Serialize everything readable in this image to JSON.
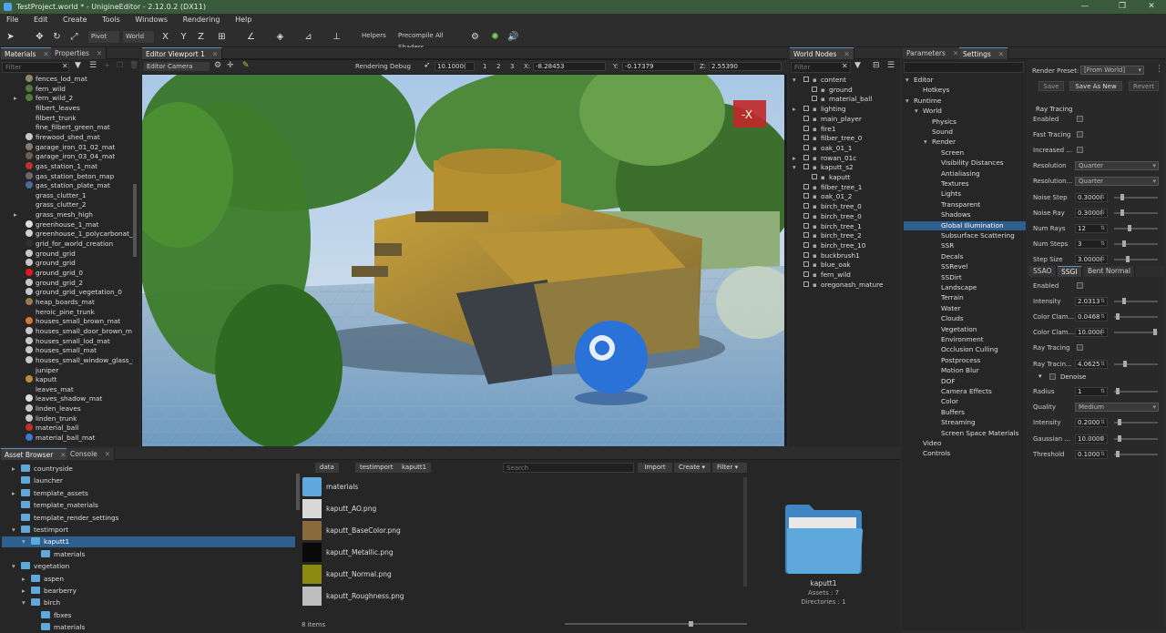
{
  "window": {
    "title": "TestProject.world * - UnigineEditor - 2.12.0.2 (DX11)"
  },
  "menu": [
    "File",
    "Edit",
    "Create",
    "Tools",
    "Windows",
    "Rendering",
    "Help"
  ],
  "toolbar": {
    "pivot": "Pivot",
    "world": "World",
    "x": "X",
    "y": "Y",
    "z": "Z",
    "helpers": "Helpers",
    "precompile": "Precompile All Shaders"
  },
  "materials_panel": {
    "tabs": [
      "Materials",
      "Properties"
    ],
    "search_placeholder": "Filter",
    "items": [
      {
        "label": "fences_lod_mat",
        "color": "#8a8a6a"
      },
      {
        "label": "fern_wild",
        "color": "#4f7a3a"
      },
      {
        "label": "fern_wild_2",
        "color": "#4f7a3a"
      },
      {
        "label": "filbert_leaves",
        "color": ""
      },
      {
        "label": "filbert_trunk",
        "color": ""
      },
      {
        "label": "fine_filbert_green_mat",
        "color": ""
      },
      {
        "label": "firewood_shed_mat",
        "color": "#c8c8c8"
      },
      {
        "label": "garage_iron_01_02_mat",
        "color": "#8a7a6a"
      },
      {
        "label": "garage_iron_03_04_mat",
        "color": "#6a6058"
      },
      {
        "label": "gas_station_1_mat",
        "color": "#c03030"
      },
      {
        "label": "gas_station_beton_map",
        "color": "#6a6a6a"
      },
      {
        "label": "gas_station_plate_mat",
        "color": "#4a6a9a"
      },
      {
        "label": "grass_clutter_1",
        "color": ""
      },
      {
        "label": "grass_clutter_2",
        "color": ""
      },
      {
        "label": "grass_mesh_high",
        "color": ""
      },
      {
        "label": "greenhouse_1_mat",
        "color": "#dddddd"
      },
      {
        "label": "greenhouse_1_polycarbonat_m",
        "color": "#d0d0d0"
      },
      {
        "label": "grid_for_world_creation",
        "color": "#303030"
      },
      {
        "label": "ground_grid",
        "color": "#c8c8c8"
      },
      {
        "label": "ground_grid",
        "color": "#c8c8c8"
      },
      {
        "label": "ground_grid_0",
        "color": "#dd1a1a"
      },
      {
        "label": "ground_grid_2",
        "color": "#c8c8c8"
      },
      {
        "label": "ground_grid_vegetation_0",
        "color": "#c8c8c8"
      },
      {
        "label": "heap_boards_mat",
        "color": "#9a7a50"
      },
      {
        "label": "heroic_pine_trunk",
        "color": ""
      },
      {
        "label": "houses_small_brown_mat",
        "color": "#d07a2a"
      },
      {
        "label": "houses_small_door_brown_m",
        "color": "#c8c8c8"
      },
      {
        "label": "houses_small_lod_mat",
        "color": "#c8c8c8"
      },
      {
        "label": "houses_small_mat",
        "color": "#c8c8c8"
      },
      {
        "label": "houses_small_window_glass_n",
        "color": "#c8c8c8"
      },
      {
        "label": "juniper",
        "color": ""
      },
      {
        "label": "kaputt",
        "color": "#b09040"
      },
      {
        "label": "leaves_mat",
        "color": ""
      },
      {
        "label": "leaves_shadow_mat",
        "color": "#dddddd"
      },
      {
        "label": "linden_leaves",
        "color": "#c8c8c8"
      },
      {
        "label": "linden_trunk",
        "color": "#c8c8c8"
      },
      {
        "label": "material_ball",
        "color": "#c03030"
      },
      {
        "label": "material_ball_mat",
        "color": "#3a7ad0"
      }
    ]
  },
  "viewport": {
    "tab": "Editor Viewport 1",
    "camera": "Editor Camera",
    "rendering_debug": "Rendering Debug",
    "speed": "10.1000(",
    "speeds": [
      "1",
      "2",
      "3"
    ],
    "x_label": "X:",
    "x": "-8.28453",
    "y_label": "Y:",
    "y": "-0.17379",
    "z_label": "Z:",
    "z": "2.55390",
    "axis_gizmo": "-X"
  },
  "world_nodes": {
    "tab": "World Nodes",
    "search_placeholder": "Filter",
    "items": [
      {
        "label": "content",
        "indent": 0,
        "expand": "▾"
      },
      {
        "label": "ground",
        "indent": 1,
        "expand": ""
      },
      {
        "label": "material_ball",
        "indent": 1,
        "expand": ""
      },
      {
        "label": "lighting",
        "indent": 0,
        "expand": "▸"
      },
      {
        "label": "main_player",
        "indent": 0,
        "expand": ""
      },
      {
        "label": "fire1",
        "indent": 0,
        "expand": ""
      },
      {
        "label": "filber_tree_0",
        "indent": 0,
        "expand": ""
      },
      {
        "label": "oak_01_1",
        "indent": 0,
        "expand": ""
      },
      {
        "label": "rowan_01c",
        "indent": 0,
        "expand": "▸"
      },
      {
        "label": "kaputt_s2",
        "indent": 0,
        "expand": "▾"
      },
      {
        "label": "kaputt",
        "indent": 1,
        "expand": ""
      },
      {
        "label": "filber_tree_1",
        "indent": 0,
        "expand": ""
      },
      {
        "label": "oak_01_2",
        "indent": 0,
        "expand": ""
      },
      {
        "label": "birch_tree_0",
        "indent": 0,
        "expand": ""
      },
      {
        "label": "birch_tree_0",
        "indent": 0,
        "expand": ""
      },
      {
        "label": "birch_tree_1",
        "indent": 0,
        "expand": ""
      },
      {
        "label": "birch_tree_2",
        "indent": 0,
        "expand": ""
      },
      {
        "label": "birch_tree_10",
        "indent": 0,
        "expand": ""
      },
      {
        "label": "buckbrush1",
        "indent": 0,
        "expand": ""
      },
      {
        "label": "blue_oak",
        "indent": 0,
        "expand": ""
      },
      {
        "label": "fern_wild",
        "indent": 0,
        "expand": ""
      },
      {
        "label": "oregonash_mature",
        "indent": 0,
        "expand": ""
      }
    ]
  },
  "settings_panel": {
    "tabs": [
      "Parameters",
      "Settings"
    ],
    "tree": [
      {
        "label": "Editor",
        "indent": 0,
        "expand": "▾"
      },
      {
        "label": "Hotkeys",
        "indent": 1,
        "expand": ""
      },
      {
        "label": "Runtime",
        "indent": 0,
        "expand": "▾"
      },
      {
        "label": "World",
        "indent": 1,
        "expand": "▾"
      },
      {
        "label": "Physics",
        "indent": 2,
        "expand": ""
      },
      {
        "label": "Sound",
        "indent": 2,
        "expand": ""
      },
      {
        "label": "Render",
        "indent": 2,
        "expand": "▾"
      },
      {
        "label": "Screen",
        "indent": 3,
        "expand": ""
      },
      {
        "label": "Visibility Distances",
        "indent": 3,
        "expand": ""
      },
      {
        "label": "Antialiasing",
        "indent": 3,
        "expand": ""
      },
      {
        "label": "Textures",
        "indent": 3,
        "expand": ""
      },
      {
        "label": "Lights",
        "indent": 3,
        "expand": ""
      },
      {
        "label": "Transparent",
        "indent": 3,
        "expand": ""
      },
      {
        "label": "Shadows",
        "indent": 3,
        "expand": ""
      },
      {
        "label": "Global Illumination",
        "indent": 3,
        "expand": ""
      },
      {
        "label": "Subsurface Scattering",
        "indent": 3,
        "expand": ""
      },
      {
        "label": "SSR",
        "indent": 3,
        "expand": ""
      },
      {
        "label": "Decals",
        "indent": 3,
        "expand": ""
      },
      {
        "label": "SSRevel",
        "indent": 3,
        "expand": ""
      },
      {
        "label": "SSDirt",
        "indent": 3,
        "expand": ""
      },
      {
        "label": "Landscape",
        "indent": 3,
        "expand": ""
      },
      {
        "label": "Terrain",
        "indent": 3,
        "expand": ""
      },
      {
        "label": "Water",
        "indent": 3,
        "expand": ""
      },
      {
        "label": "Clouds",
        "indent": 3,
        "expand": ""
      },
      {
        "label": "Vegetation",
        "indent": 3,
        "expand": ""
      },
      {
        "label": "Environment",
        "indent": 3,
        "expand": ""
      },
      {
        "label": "Occlusion Culling",
        "indent": 3,
        "expand": ""
      },
      {
        "label": "Postprocess",
        "indent": 3,
        "expand": ""
      },
      {
        "label": "Motion Blur",
        "indent": 3,
        "expand": ""
      },
      {
        "label": "DOF",
        "indent": 3,
        "expand": ""
      },
      {
        "label": "Camera Effects",
        "indent": 3,
        "expand": ""
      },
      {
        "label": "Color",
        "indent": 3,
        "expand": ""
      },
      {
        "label": "Buffers",
        "indent": 3,
        "expand": ""
      },
      {
        "label": "Streaming",
        "indent": 3,
        "expand": ""
      },
      {
        "label": "Screen Space Materials",
        "indent": 3,
        "expand": ""
      },
      {
        "label": "Video",
        "indent": 1,
        "expand": ""
      },
      {
        "label": "Controls",
        "indent": 1,
        "expand": ""
      }
    ],
    "selected": "Global Illumination"
  },
  "render_props": {
    "preset_label": "Render Preset:",
    "preset_value": "[From World]",
    "buttons": [
      "Save",
      "Save As New",
      "Revert"
    ],
    "ray_tracing_title": "Ray Tracing",
    "ray_tracing": [
      {
        "label": "Enabled",
        "type": "check"
      },
      {
        "label": "Fast Tracing",
        "type": "check"
      },
      {
        "label": "Increased ...",
        "type": "check"
      },
      {
        "label": "Resolution",
        "type": "dd",
        "value": "Quarter"
      },
      {
        "label": "Resolution...",
        "type": "dd",
        "value": "Quarter"
      },
      {
        "label": "Noise Step",
        "type": "num",
        "value": "0.3000(",
        "level": 0.15
      },
      {
        "label": "Noise Ray",
        "type": "num",
        "value": "0.3000(",
        "level": 0.15
      },
      {
        "label": "Num Rays",
        "type": "num",
        "value": "12",
        "level": 0.35
      },
      {
        "label": "Num Steps",
        "type": "num",
        "value": "3",
        "level": 0.2
      },
      {
        "label": "Step Size",
        "type": "num",
        "value": "3.0000(",
        "level": 0.3
      }
    ],
    "sub_tabs": [
      "SSAO",
      "SSGI",
      "Bent Normal"
    ],
    "ssgi": [
      {
        "label": "Enabled",
        "type": "check"
      },
      {
        "label": "Intensity",
        "type": "num",
        "value": "2.0313",
        "level": 0.2
      },
      {
        "label": "Color Clam...",
        "type": "num",
        "value": "0.0468",
        "level": 0.05
      },
      {
        "label": "Color Clam...",
        "type": "num",
        "value": "10.000(",
        "level": 0.98
      },
      {
        "label": "Ray Tracing",
        "type": "check"
      },
      {
        "label": "Ray Tracin...",
        "type": "num",
        "value": "4.0625",
        "level": 0.22
      }
    ],
    "denoise_title": "Denoise",
    "denoise": [
      {
        "label": "Radius",
        "type": "num",
        "value": "1",
        "level": 0.04
      },
      {
        "label": "Quality",
        "type": "dd",
        "value": "Medium"
      },
      {
        "label": "Intensity",
        "type": "num",
        "value": "0.2000",
        "level": 0.1
      },
      {
        "label": "Gaussian ...",
        "type": "num",
        "value": "10.0000",
        "level": 0.1
      },
      {
        "label": "Threshold",
        "type": "num",
        "value": "0.1000",
        "level": 0.05
      }
    ]
  },
  "asset_browser": {
    "tabs": [
      "Asset Browser",
      "Console"
    ],
    "tree": [
      {
        "label": "countryside",
        "indent": 1,
        "expand": "▸"
      },
      {
        "label": "launcher",
        "indent": 1,
        "expand": ""
      },
      {
        "label": "template_assets",
        "indent": 1,
        "expand": "▸"
      },
      {
        "label": "template_materials",
        "indent": 1,
        "expand": ""
      },
      {
        "label": "template_render_settings",
        "indent": 1,
        "expand": ""
      },
      {
        "label": "testimport",
        "indent": 1,
        "expand": "▾"
      },
      {
        "label": "kaputt1",
        "indent": 2,
        "expand": "▾"
      },
      {
        "label": "materials",
        "indent": 3,
        "expand": ""
      },
      {
        "label": "vegetation",
        "indent": 1,
        "expand": "▾"
      },
      {
        "label": "aspen",
        "indent": 2,
        "expand": "▸"
      },
      {
        "label": "bearberry",
        "indent": 2,
        "expand": "▸"
      },
      {
        "label": "birch",
        "indent": 2,
        "expand": "▾"
      },
      {
        "label": "fbxes",
        "indent": 3,
        "expand": ""
      },
      {
        "label": "materials",
        "indent": 3,
        "expand": ""
      }
    ],
    "selected": "kaputt1",
    "breadcrumbs": [
      "data",
      "testimport",
      "kaputt1"
    ],
    "search_placeholder": "Search",
    "import": "Import",
    "create": "Create",
    "filter": "Filter",
    "files": [
      {
        "label": "materials",
        "thumb": "#5fa8dc"
      },
      {
        "label": "kaputt_AO.png",
        "thumb": "#d8d8d8"
      },
      {
        "label": "kaputt_BaseColor.png",
        "thumb": "#8a6a3a"
      },
      {
        "label": "kaputt_Metallic.png",
        "thumb": "#0a0a0a"
      },
      {
        "label": "kaputt_Normal.png",
        "thumb": "#8a8a10"
      },
      {
        "label": "kaputt_Roughness.png",
        "thumb": "#bdbdbd"
      }
    ],
    "items_count": "8 items",
    "preview_name": "kaputt1",
    "preview_assets": "Assets : 7",
    "preview_dirs": "Directories : 1"
  },
  "colors": {
    "accent": "#2f5f8f",
    "titlebar": "#3a5a3c",
    "folder": "#5fa8dc"
  }
}
